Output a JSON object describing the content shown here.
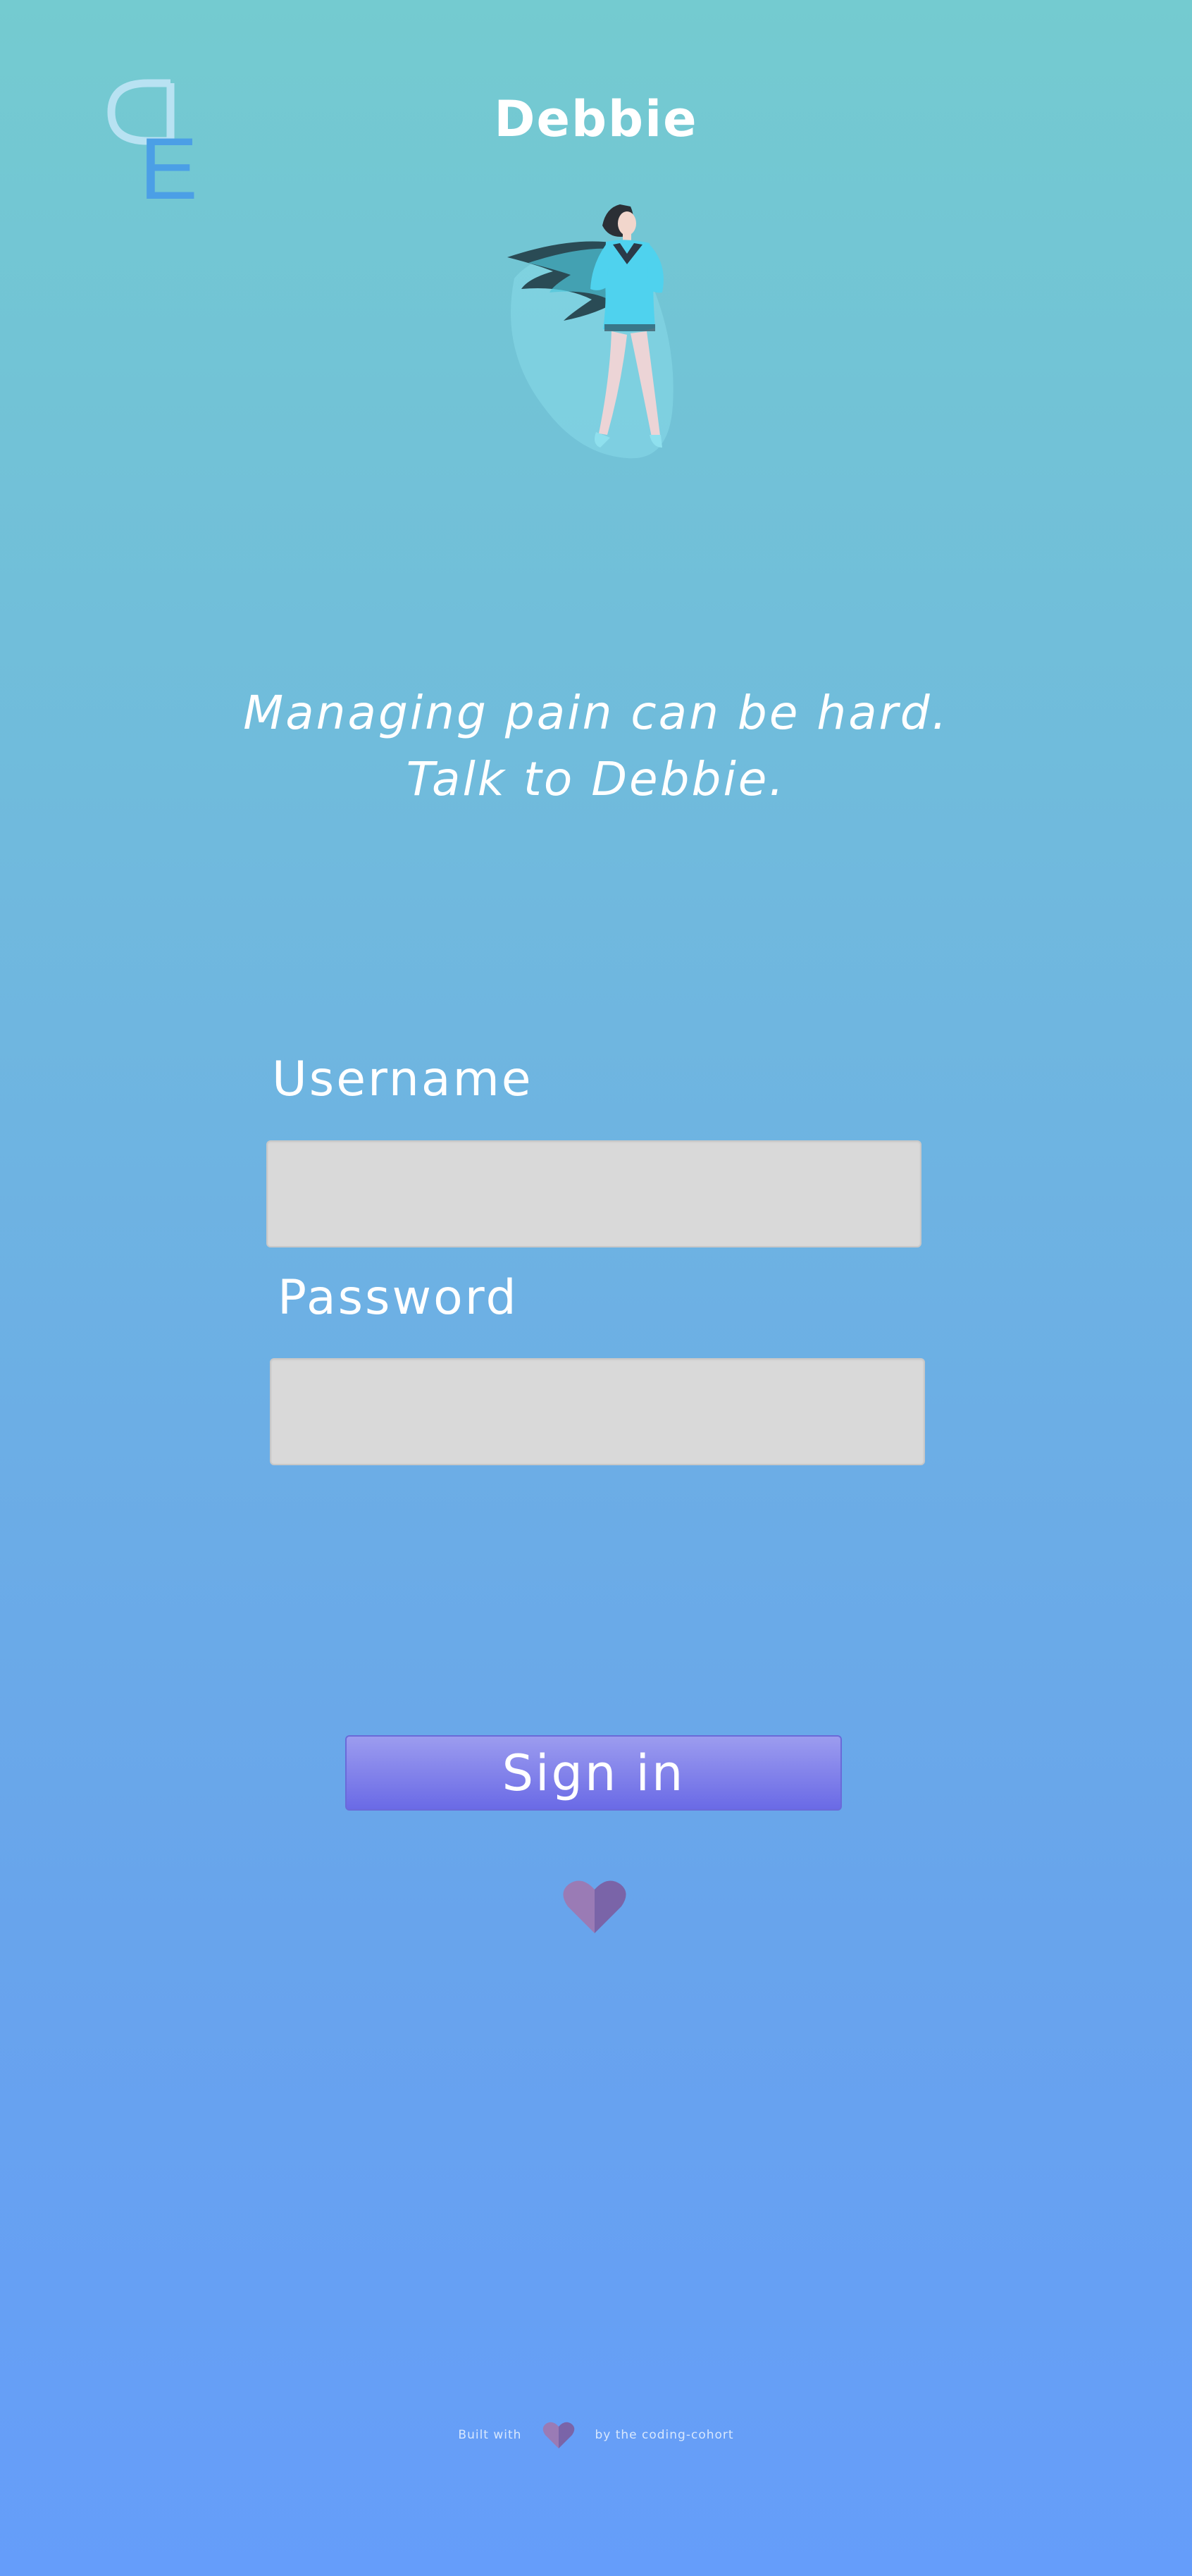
{
  "app": {
    "title": "Debbie",
    "logo_letter": "E"
  },
  "hero": {
    "icon": "superhero-woman-illustration"
  },
  "tagline": {
    "line1": "Managing pain can be hard.",
    "line2": "Talk to Debbie."
  },
  "form": {
    "username_label": "Username",
    "username_value": "",
    "password_label": "Password",
    "password_value": "",
    "signin_label": "Sign in"
  },
  "footer": {
    "prefix": "Built with",
    "suffix": "by the coding-cohort",
    "icon": "heart-icon"
  },
  "colors": {
    "bg_top": "#74cbd0",
    "bg_bottom": "#659dfa",
    "input_bg": "#d9d9d9",
    "button_top": "#9c9cef",
    "button_bottom": "#6a6ae6",
    "heart_left": "#9a7bb5",
    "heart_right": "#7a64a8"
  }
}
